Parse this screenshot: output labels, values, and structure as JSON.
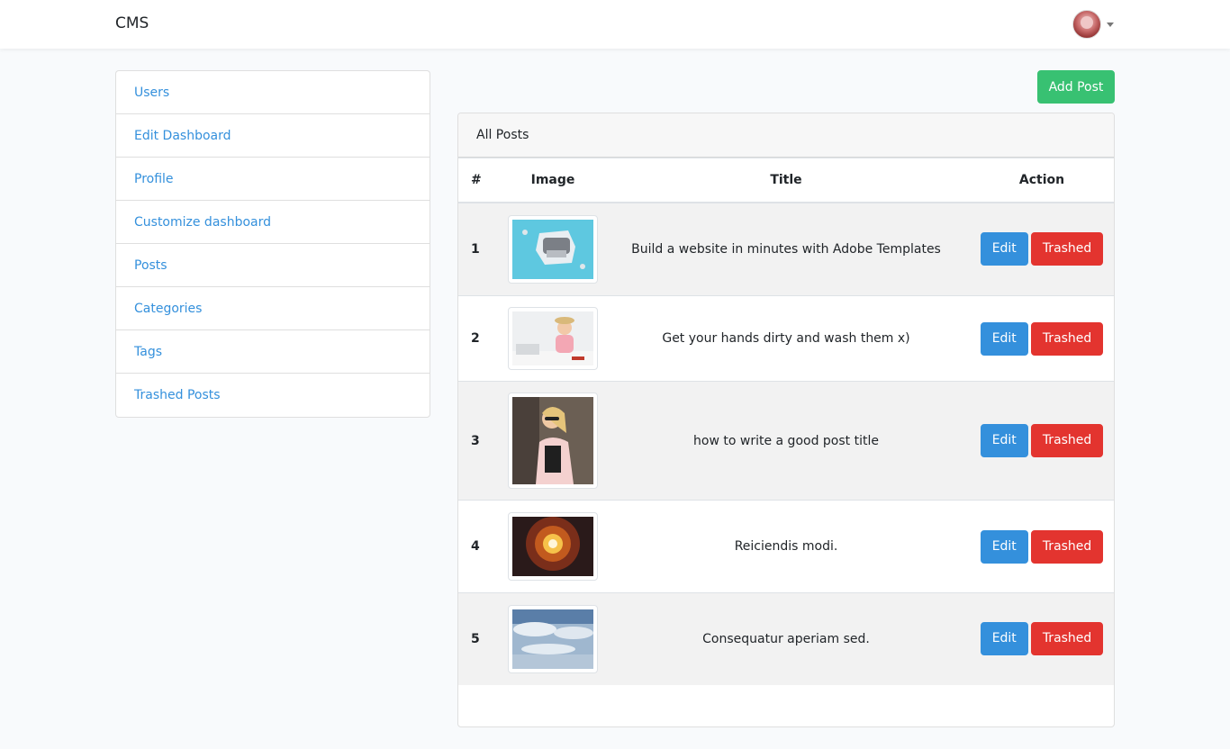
{
  "navbar": {
    "brand": "CMS"
  },
  "sidebar": {
    "items": [
      {
        "label": "Users"
      },
      {
        "label": "Edit Dashboard"
      },
      {
        "label": "Profile"
      },
      {
        "label": "Customize dashboard"
      },
      {
        "label": "Posts"
      },
      {
        "label": "Categories"
      },
      {
        "label": "Tags"
      },
      {
        "label": "Trashed Posts"
      }
    ]
  },
  "toolbar": {
    "add_label": "Add Post"
  },
  "posts": {
    "header": "All Posts",
    "columns": {
      "num": "#",
      "image": "Image",
      "title": "Title",
      "action": "Action"
    },
    "edit_label": "Edit",
    "trash_label": "Trashed",
    "rows": [
      {
        "num": "1",
        "title": "Build a website in minutes with Adobe Templates"
      },
      {
        "num": "2",
        "title": "Get your hands dirty and wash them x)"
      },
      {
        "num": "3",
        "title": "how to write a good post title"
      },
      {
        "num": "4",
        "title": "Reiciendis modi."
      },
      {
        "num": "5",
        "title": "Consequatur aperiam sed."
      }
    ]
  },
  "colors": {
    "primary": "#3490dc",
    "success": "#38c172",
    "danger": "#e3342f"
  }
}
